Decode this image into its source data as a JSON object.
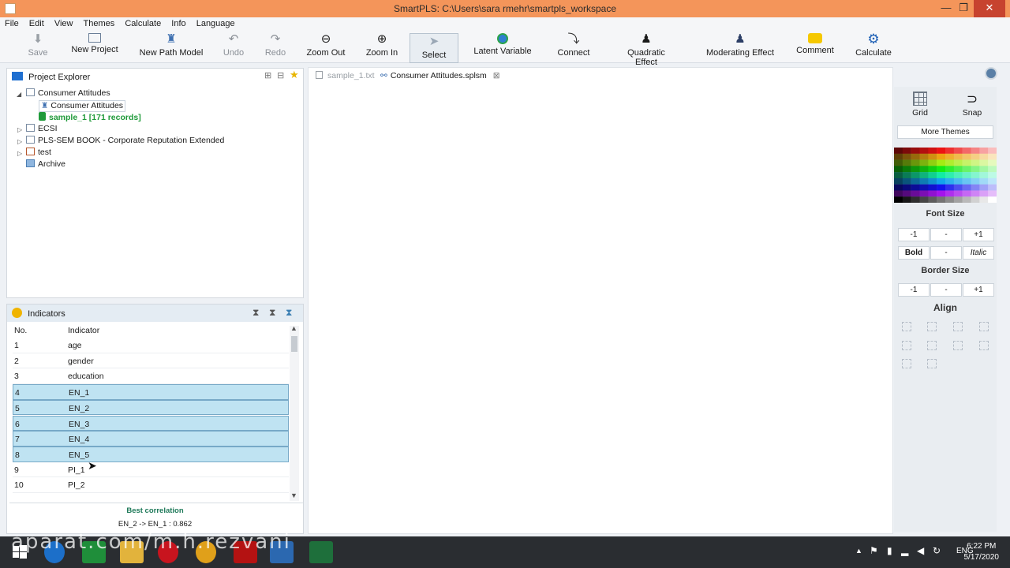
{
  "window": {
    "title": "SmartPLS: C:\\Users\\sara rmehr\\smartpls_workspace",
    "minimize": "—",
    "maximize": "❐",
    "close": "✕"
  },
  "menu": [
    "File",
    "Edit",
    "View",
    "Themes",
    "Calculate",
    "Info",
    "Language"
  ],
  "toolbar": {
    "save": "Save",
    "new_project": "New Project",
    "new_path_model": "New Path Model",
    "undo": "Undo",
    "redo": "Redo",
    "zoom_out": "Zoom Out",
    "zoom_in": "Zoom In",
    "select": "Select",
    "latent_variable": "Latent Variable",
    "connect": "Connect",
    "quadratic_effect": "Quadratic Effect",
    "moderating_effect": "Moderating Effect",
    "comment": "Comment",
    "calculate": "Calculate"
  },
  "project_explorer": {
    "title": "Project Explorer",
    "items": [
      "Consumer Attitudes",
      "Consumer Attitudes",
      "sample_1 [171 records]",
      "ECSI",
      "PLS-SEM BOOK - Corporate Reputation Extended",
      "test",
      "Archive"
    ]
  },
  "indicators": {
    "title": "Indicators",
    "col_no": "No.",
    "col_indicator": "Indicator",
    "rows": [
      {
        "no": "1",
        "name": "age"
      },
      {
        "no": "2",
        "name": "gender"
      },
      {
        "no": "3",
        "name": "education"
      },
      {
        "no": "4",
        "name": "EN_1"
      },
      {
        "no": "5",
        "name": "EN_2"
      },
      {
        "no": "6",
        "name": "EN_3"
      },
      {
        "no": "7",
        "name": "EN_4"
      },
      {
        "no": "8",
        "name": "EN_5"
      },
      {
        "no": "9",
        "name": "PI_1"
      },
      {
        "no": "10",
        "name": "PI_2"
      }
    ],
    "best_correlation_label": "Best correlation",
    "best_correlation_value": "EN_2 -> EN_1 : 0.862"
  },
  "tabs": [
    {
      "label": "sample_1.txt"
    },
    {
      "label": "Consumer Attitudes.splsm"
    }
  ],
  "themes": {
    "grid": "Grid",
    "snap": "Snap",
    "more_themes": "More Themes",
    "font_size": "Font Size",
    "minus1": "-1",
    "dash": "-",
    "plus1": "+1",
    "bold": "Bold",
    "italic": "Italic",
    "border_size": "Border Size",
    "align": "Align"
  },
  "taskbar": {
    "lang": "ENG",
    "time": "6:22 PM",
    "date": "5/17/2020"
  },
  "watermark": "aparat.com/m.h.rezvani",
  "colors": {
    "title_bar": "#f4955a",
    "selection": "#bfe3f2",
    "accent_green": "#1f9a3a"
  }
}
